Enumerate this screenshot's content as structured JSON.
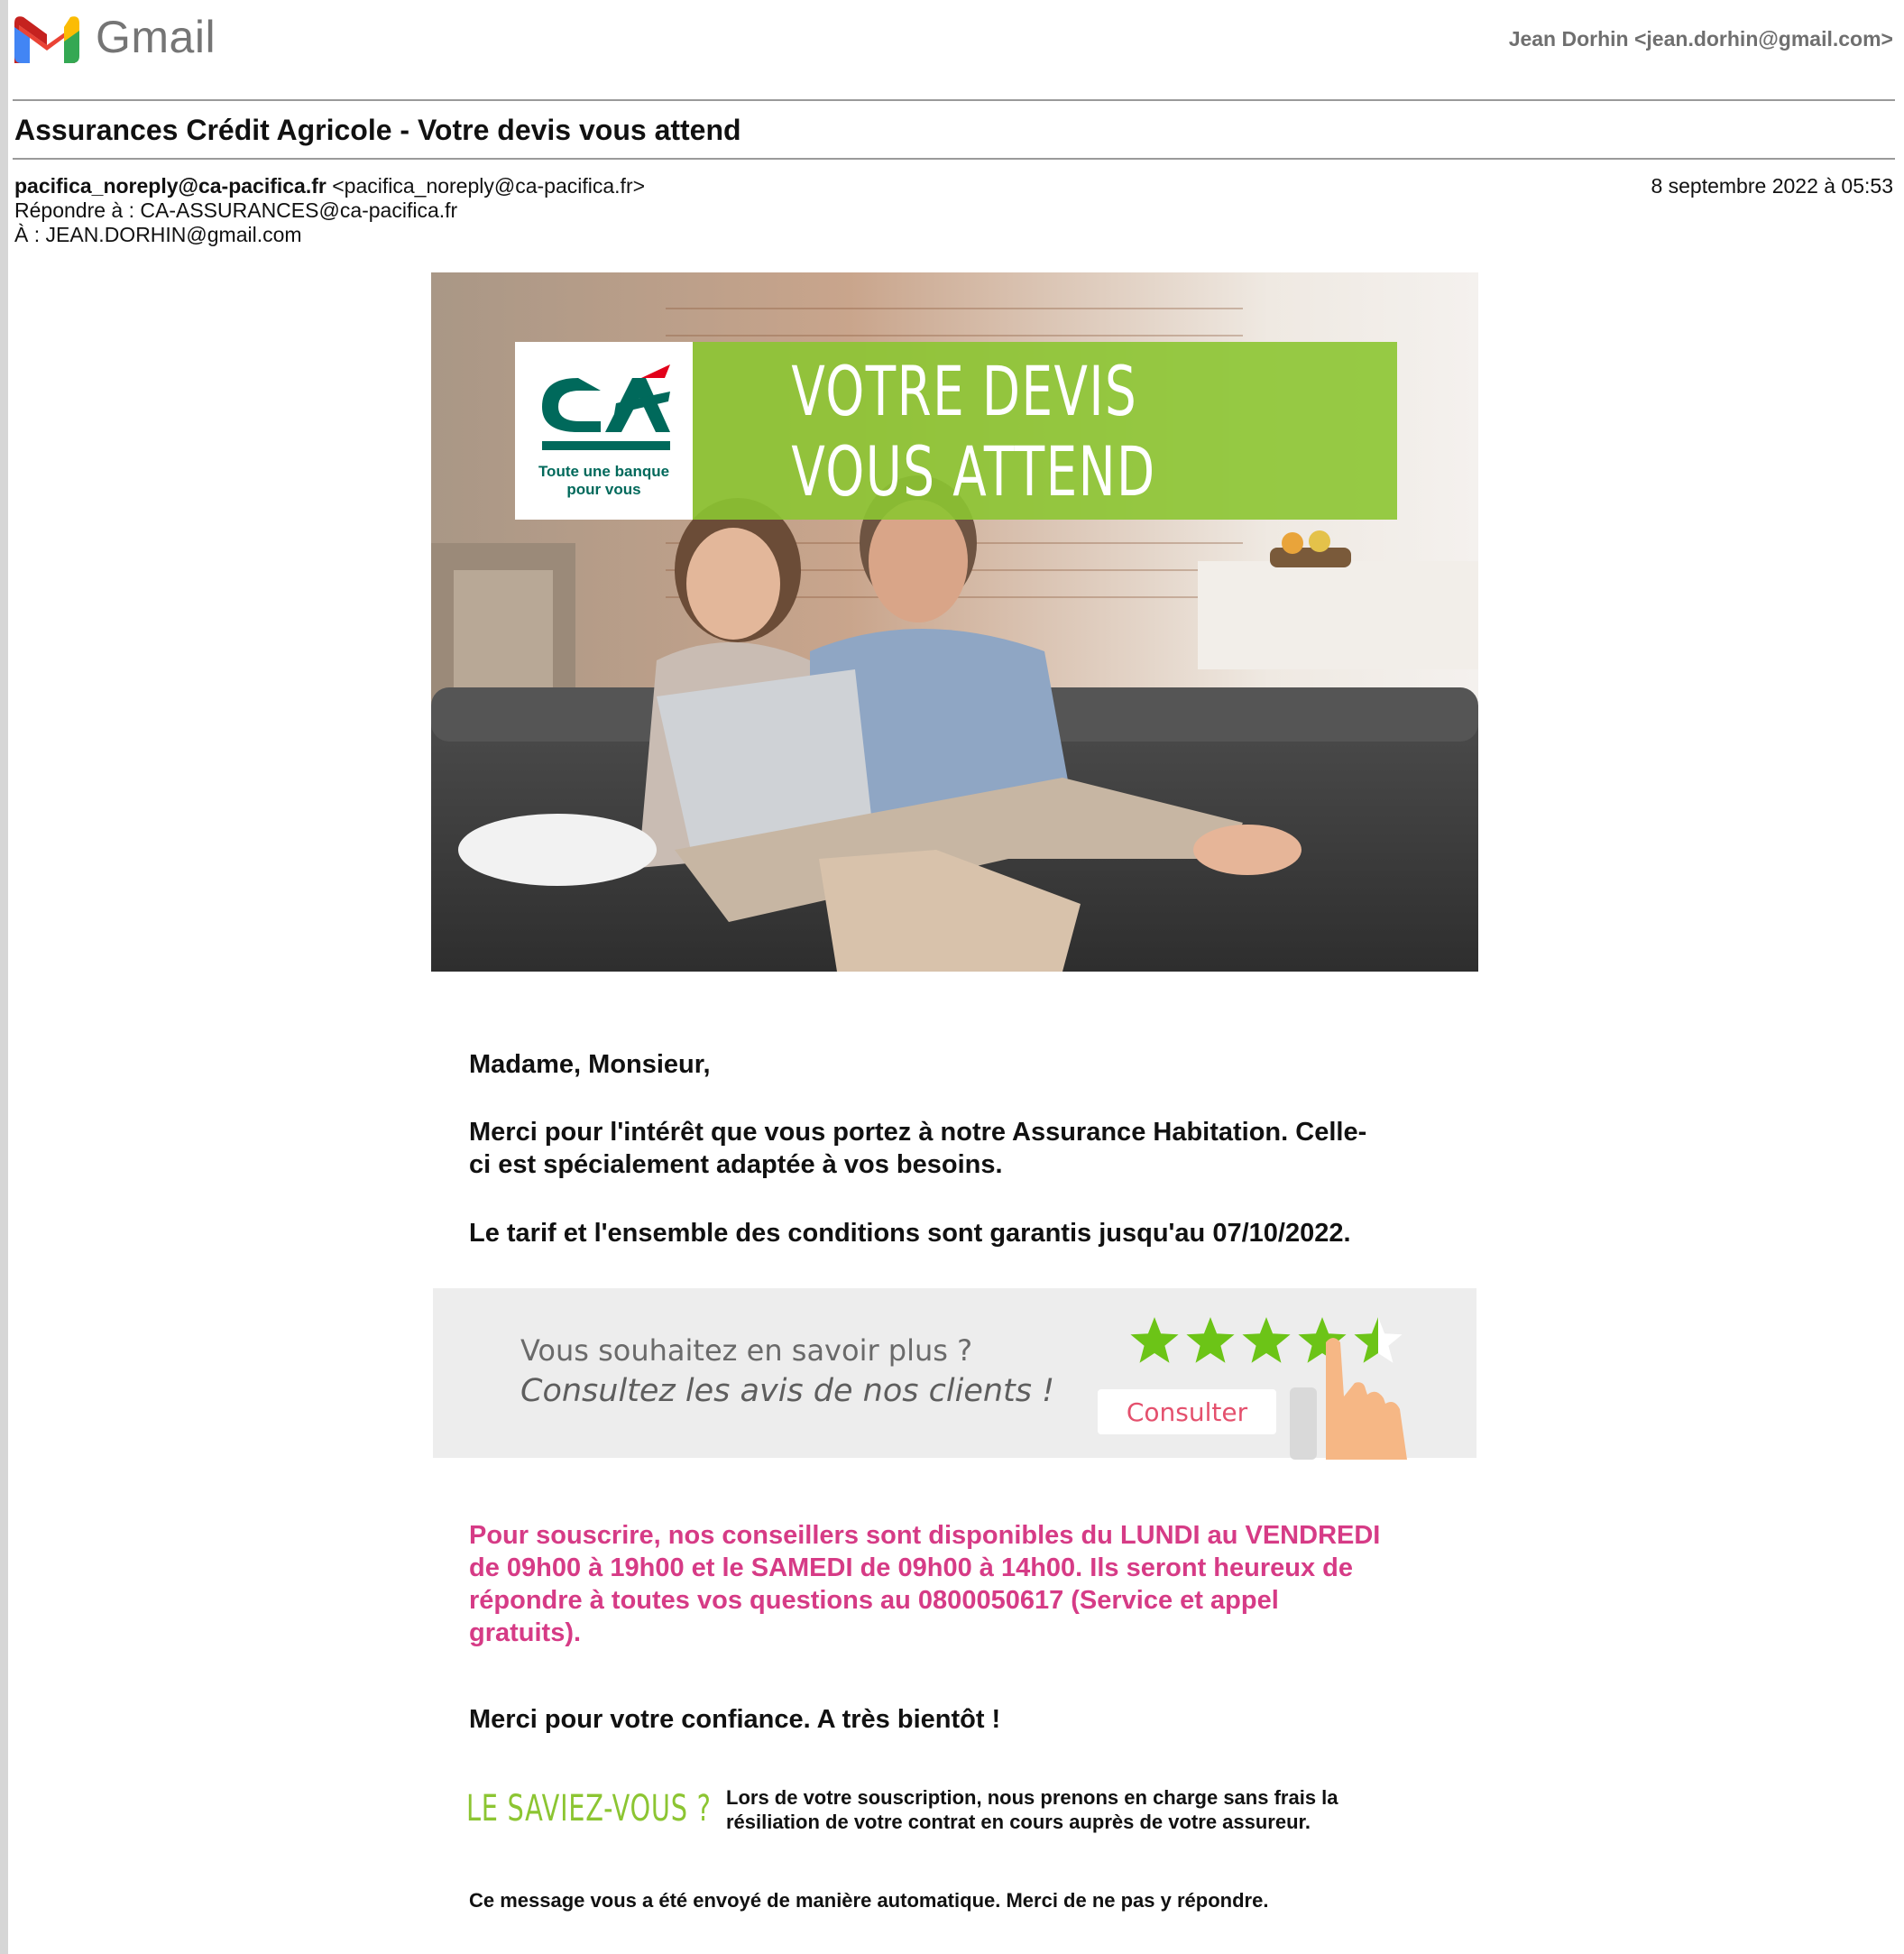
{
  "header": {
    "app_name": "Gmail",
    "account": "Jean Dorhin <jean.dorhin@gmail.com>"
  },
  "email": {
    "subject": "Assurances Crédit Agricole - Votre devis vous attend",
    "from_name": "pacifica_noreply@ca-pacifica.fr",
    "from_address": "<pacifica_noreply@ca-pacifica.fr>",
    "reply_to": "Répondre à : CA-ASSURANCES@ca-pacifica.fr",
    "to": "À : JEAN.DORHIN@gmail.com",
    "date": "8 septembre 2022 à 05:53"
  },
  "hero": {
    "logo_mark": "CA",
    "logo_tagline_1": "Toute une banque",
    "logo_tagline_2": "pour vous",
    "banner_text": "VOTRE DEVIS VOUS ATTEND"
  },
  "body": {
    "greeting": "Madame, Monsieur,",
    "para1_line1": "Merci pour l'intérêt que vous portez à notre Assurance Habitation. Celle-",
    "para1_line2": "ci est spécialement adaptée à vos besoins.",
    "para2": "Le tarif et l'ensemble des conditions sont garantis jusqu'au 07/10/2022.",
    "pink_line1": "Pour souscrire, nos conseillers sont disponibles du LUNDI au VENDREDI",
    "pink_line2": "de 09h00 à 19h00 et le SAMEDI de 09h00 à 14h00. Ils seront heureux de",
    "pink_line3": "répondre à toutes vos questions au 0800050617 (Service et appel",
    "pink_line4": "gratuits).",
    "thanks": "Merci pour votre confiance. A très bientôt !"
  },
  "reviews": {
    "question": "Vous souhaitez en savoir plus ?",
    "cta_text": "Consultez les avis de nos clients !",
    "button_label": "Consulter",
    "rating": 4.5,
    "max_rating": 5
  },
  "did_you_know": {
    "title": "LE SAVIEZ-VOUS ?",
    "line1": "Lors de votre souscription, nous prenons en charge sans frais la",
    "line2": "résiliation de votre contrat en cours auprès de votre assureur."
  },
  "footer": {
    "note": "Ce message vous a été envoyé de manière automatique. Merci de ne pas y répondre."
  },
  "colors": {
    "ca_green": "#00695b",
    "banner_green": "#8cc532",
    "pink": "#d63b86",
    "star_green": "#6cc417",
    "button_text": "#e4506d"
  }
}
